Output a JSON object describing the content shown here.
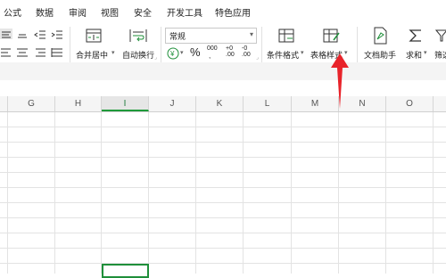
{
  "menu": {
    "items": [
      "公式",
      "数据",
      "审阅",
      "视图",
      "安全",
      "开发工具",
      "特色应用"
    ]
  },
  "toolbar": {
    "merge_center_label": "合并居中",
    "wrap_text_label": "自动换行",
    "number_format_value": "常规",
    "percent_symbol": "%",
    "thousands_symbol": "000",
    "inc_decimal_symbol": "+0\n.00",
    "dec_decimal_symbol": "-0\n.00",
    "conditional_format_label": "条件格式",
    "table_style_label": "表格样式",
    "doc_assistant_label": "文档助手",
    "sum_label": "求和",
    "filter_label": "筛选"
  },
  "sheet": {
    "columns": [
      "G",
      "H",
      "I",
      "J",
      "K",
      "L",
      "M",
      "N",
      "O"
    ],
    "selected_column": "I"
  },
  "colors": {
    "accent_green": "#1f8f3a",
    "arrow_red": "#e8232a"
  }
}
